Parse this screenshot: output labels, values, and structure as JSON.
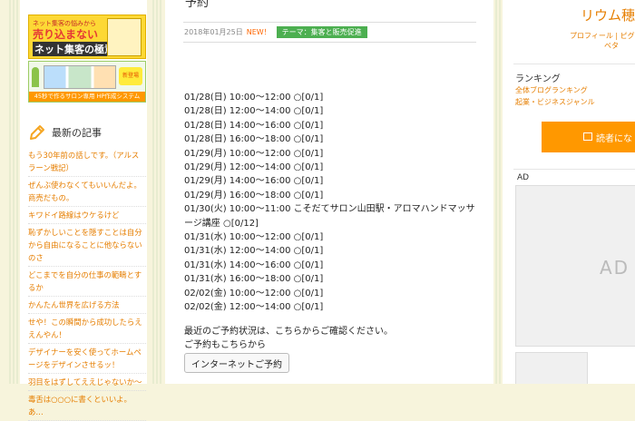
{
  "left_sidebar": {
    "banner1": {
      "line1": "ネット集客の悩みから",
      "line2": "売り込まない",
      "line3": "ネット集客の極意"
    },
    "banner2": {
      "badge": "新登場",
      "caption": "45秒で作るサロン専用 HP作成システム"
    },
    "recent_title": "最新の記事",
    "recent_items": [
      "もう30年前の話しです。（アルスラーン戦記）",
      "ぜんぶ使わなくてもいいんだよ。商売だもの。",
      "キワドイ路線はウケるけど",
      "恥ずかしいことを隠すことは自分から自由になることに他ならないのさ",
      "どこまでを自分の仕事の範疇とするか",
      "かんたん世界を広げる方法",
      "せや！この瞬間から成功したらええんやん！",
      "デザイナーを安く使ってホームページをデザインさせるッ！",
      "羽目をはずしてええじゃないか〜",
      "毒舌は○○○に書くといいよ。あ…"
    ]
  },
  "article": {
    "title_partial": "予約",
    "date": "2018年01月25日",
    "new_label": "NEW！",
    "theme_label": "テーマ：集客と販売促進",
    "schedule": [
      "01/28(日) 10:00〜12:00 ○[0/1]",
      "01/28(日) 12:00〜14:00 ○[0/1]",
      "01/28(日) 14:00〜16:00 ○[0/1]",
      "01/28(日) 16:00〜18:00 ○[0/1]",
      "01/29(月) 10:00〜12:00 ○[0/1]",
      "01/29(月) 12:00〜14:00 ○[0/1]",
      "01/29(月) 14:00〜16:00 ○[0/1]",
      "01/29(月) 16:00〜18:00 ○[0/1]",
      "01/30(火) 10:00〜11:00 こそだてサロン山田駅・アロマハンドマッサージ講座 ○[0/12]",
      "01/31(水) 10:00〜12:00 ○[0/1]",
      "01/31(水) 12:00〜14:00 ○[0/1]",
      "01/31(水) 14:00〜16:00 ○[0/1]",
      "01/31(水) 16:00〜18:00 ○[0/1]",
      "02/02(金) 10:00〜12:00 ○[0/1]",
      "02/02(金) 12:00〜14:00 ○[0/1]"
    ],
    "note_line1": "最近のご予約状況は、こちらからご確認ください。",
    "note_line2": "ご予約もこちらから",
    "reserve_button": "インターネットご予約"
  },
  "right_sidebar": {
    "blog_name": "リウム穂積",
    "profile_links": "プロフィール | ピグ",
    "beta": "ベタ",
    "ranking_title": "ランキング",
    "ranking_1": "全体ブログランキング",
    "ranking_2": "起業・ビジネスジャンル",
    "reader_button": "読者にな",
    "ad_label": "AD",
    "ad_placeholder": "AD"
  },
  "colors": {
    "accent": "#e67e00",
    "theme_green": "#4caf50",
    "reader_orange": "#ff9800",
    "background": "#f7f4dc"
  }
}
